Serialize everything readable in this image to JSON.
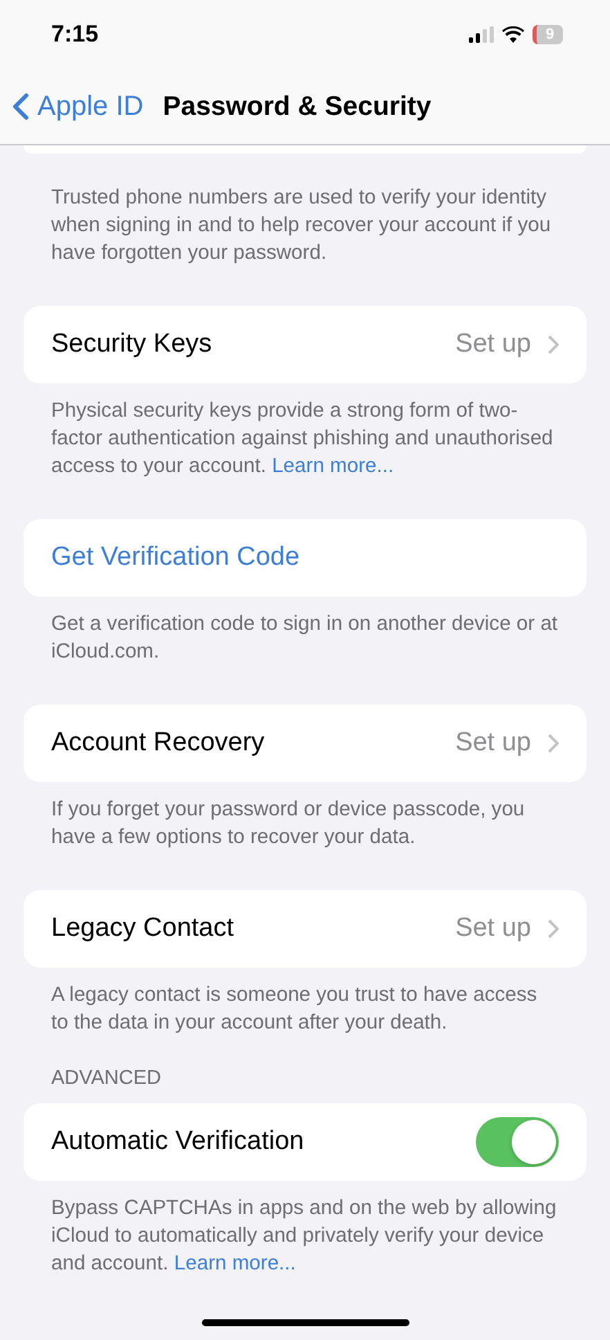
{
  "status_bar": {
    "time": "7:15",
    "battery": "9"
  },
  "nav": {
    "back": "Apple ID",
    "title": "Password & Security"
  },
  "sections": [
    {
      "footer": {
        "text": "Trusted phone numbers are used to verify your identity when signing in and to help recover your account if you have forgotten your password."
      }
    },
    {
      "row": {
        "kind": "disclosure",
        "label": "Security Keys",
        "value": "Set up"
      },
      "footer": {
        "text": "Physical security keys provide a strong form of two-factor authentication against phishing and unauthorised access to your account.",
        "link": "Learn more..."
      }
    },
    {
      "row": {
        "kind": "action",
        "label": "Get Verification Code"
      },
      "footer": {
        "text": "Get a verification code to sign in on another device or at iCloud.com."
      }
    },
    {
      "row": {
        "kind": "disclosure",
        "label": "Account Recovery",
        "value": "Set up"
      },
      "footer": {
        "text": "If you forget your password or device passcode, you have a few options to recover your data."
      }
    },
    {
      "row": {
        "kind": "disclosure",
        "label": "Legacy Contact",
        "value": "Set up"
      },
      "footer": {
        "text": "A legacy contact is someone you trust to have access to the data in your account after your death."
      }
    },
    {
      "header": "ADVANCED",
      "row": {
        "kind": "toggle",
        "label": "Automatic Verification",
        "on": true
      },
      "footer": {
        "text": "Bypass CAPTCHAs in apps and on the web by allowing iCloud to automatically and privately verify your device and account.",
        "link": "Learn more..."
      }
    }
  ]
}
